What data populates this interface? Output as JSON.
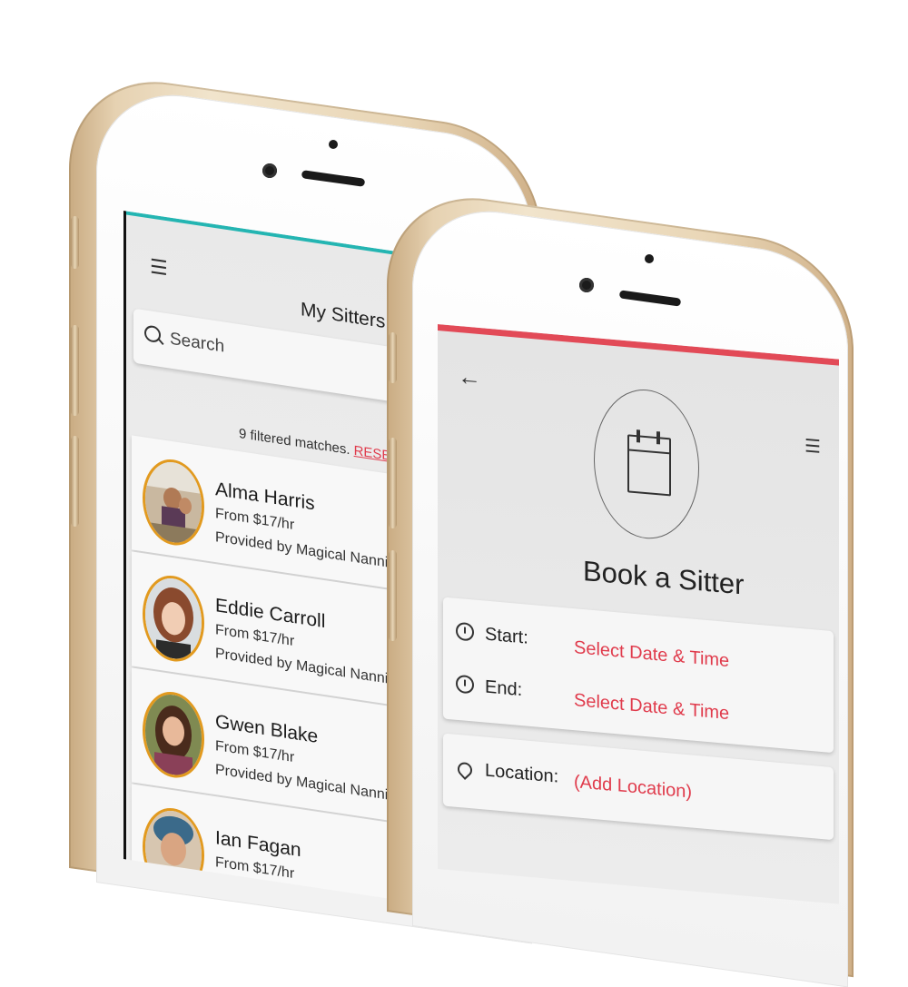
{
  "colors": {
    "accent_teal": "#24b5b2",
    "accent_red": "#e24a57",
    "link_red": "#e03b4c",
    "avatar_ring": "#e29a1f",
    "phone_gold": "#e6d2b2"
  },
  "sitters_screen": {
    "menu_icon": "hamburger-icon",
    "title": "My Sitters",
    "search": {
      "placeholder": "Search",
      "icon": "search-icon"
    },
    "matches_text": "9 filtered matches.",
    "reset_label": "RESET",
    "sitters": [
      {
        "name": "Alma Harris",
        "price": "From $17/hr",
        "provider": "Provided by Magical Nannies"
      },
      {
        "name": "Eddie Carroll",
        "price": "From $17/hr",
        "provider": "Provided by Magical Nannies"
      },
      {
        "name": "Gwen Blake",
        "price": "From $17/hr",
        "provider": "Provided by Magical Nannies"
      },
      {
        "name": "Ian Fagan",
        "price": "From $17/hr",
        "provider": ""
      }
    ]
  },
  "booking_screen": {
    "back_icon": "back-arrow-icon",
    "menu_icon": "hamburger-icon",
    "hero_icon": "calendar-icon",
    "title": "Book a Sitter",
    "start_label": "Start:",
    "start_value": "Select Date & Time",
    "end_label": "End:",
    "end_value": "Select Date & Time",
    "location_label": "Location:",
    "location_value": "(Add Location)"
  }
}
